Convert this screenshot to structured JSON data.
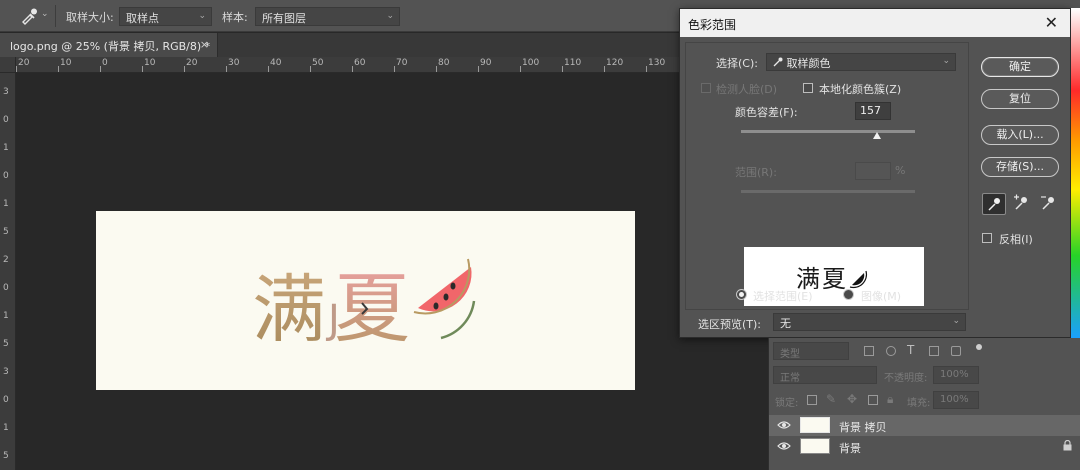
{
  "options_bar": {
    "sample_size_label": "取样大小:",
    "sample_size_value": "取样点",
    "sample_label": "样本:",
    "sample_value": "所有图层"
  },
  "document": {
    "tab_title": "logo.png @ 25% (背景 拷贝, RGB/8) *",
    "close": "×"
  },
  "rulers": {
    "horizontal": [
      "20",
      "10",
      "0",
      "10",
      "20",
      "30",
      "40",
      "50",
      "60",
      "70",
      "80",
      "90",
      "100",
      "110",
      "120",
      "130"
    ],
    "vertical": [
      "3",
      "0",
      "1",
      "0",
      "1",
      "5",
      "2",
      "0",
      "1",
      "5",
      "3",
      "0",
      "1",
      "5"
    ]
  },
  "artwork": {
    "text": "满",
    "text2": "夏",
    "text3": "J"
  },
  "dialog": {
    "title": "色彩范围",
    "close": "✕",
    "select_label": "选择(C):",
    "select_value": "取样颜色",
    "detect_faces": "检测人脸(D)",
    "localized_clusters": "本地化颜色簇(Z)",
    "fuzziness_label": "颜色容差(F):",
    "fuzziness_value": "157",
    "fuzziness_fraction": 0.78,
    "range_label": "范围(R):",
    "range_unit": "%",
    "preview_text": "满",
    "preview_text2": "夏",
    "radio_selection": "选择范围(E)",
    "radio_image": "图像(M)",
    "selection_preview_label": "选区预览(T):",
    "selection_preview_value": "无",
    "buttons": {
      "ok": "确定",
      "reset": "复位",
      "load": "载入(L)...",
      "save": "存储(S)..."
    },
    "invert_label": "反相(I)"
  },
  "layers_panel": {
    "filter_placeholder": "类型",
    "blend_mode": "正常",
    "opacity_label": "不透明度:",
    "opacity_value": "100%",
    "lock_label": "锁定:",
    "fill_label": "填充:",
    "fill_value": "100%",
    "layers": [
      {
        "name": "背景 拷贝",
        "selected": true
      },
      {
        "name": "背景",
        "selected": false
      }
    ]
  },
  "colors": {
    "accent_red": "#f1666a",
    "gold": "#b89668",
    "rind_green": "#6f8a5a"
  }
}
